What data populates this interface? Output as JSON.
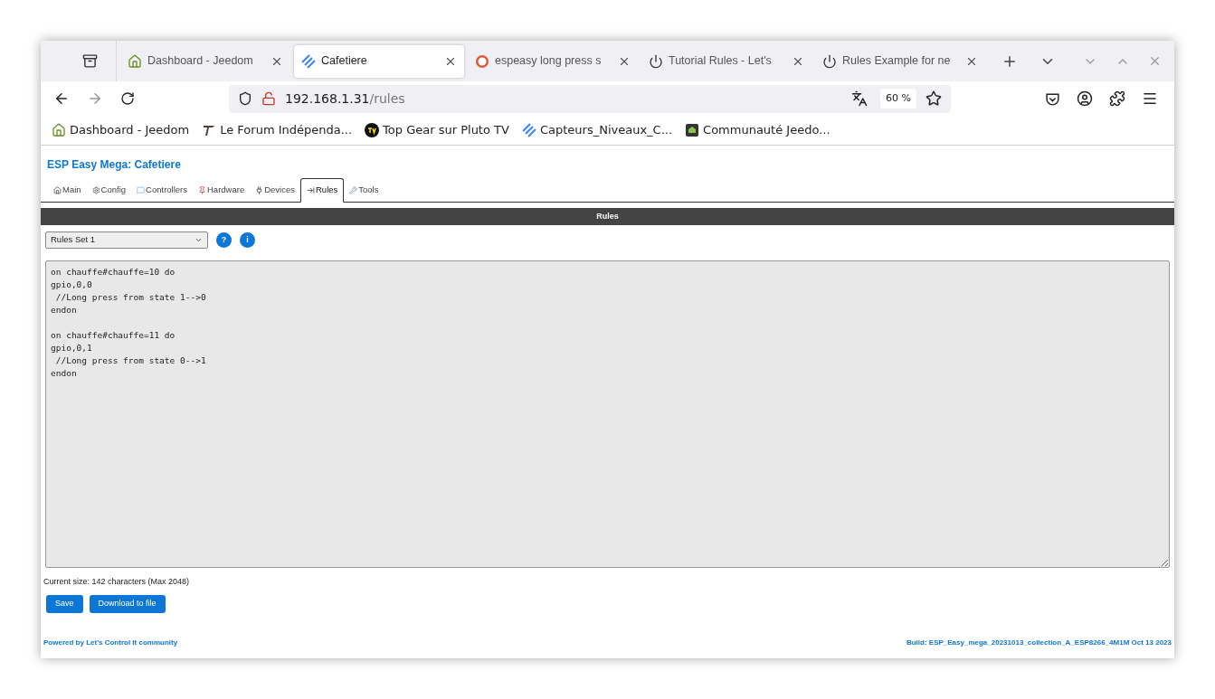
{
  "browser": {
    "tabs": [
      {
        "title": "Dashboard - Jeedom",
        "selected": false
      },
      {
        "title": "Cafetiere",
        "selected": true
      },
      {
        "title": "espeasy long press s",
        "selected": false
      },
      {
        "title": "Tutorial Rules - Let's",
        "selected": false
      },
      {
        "title": "Rules Example for ne",
        "selected": false
      }
    ],
    "address": {
      "host": "192.168.1.31",
      "path": "/rules"
    },
    "zoom": "60 %",
    "bookmarks": [
      "Dashboard - Jeedom",
      "Le Forum Indépenda...",
      "Top Gear sur Pluto TV",
      "Capteurs_Niveaux_C...",
      "Communauté Jeedo..."
    ]
  },
  "page": {
    "title": "ESP Easy Mega: Cafetiere",
    "nav": [
      {
        "label": "Main",
        "selected": false
      },
      {
        "label": "Config",
        "selected": false
      },
      {
        "label": "Controllers",
        "selected": false
      },
      {
        "label": "Hardware",
        "selected": false
      },
      {
        "label": "Devices",
        "selected": false
      },
      {
        "label": "Rules",
        "selected": true
      },
      {
        "label": "Tools",
        "selected": false
      }
    ],
    "section_header": "Rules",
    "rules_set": {
      "value": "Rules Set 1"
    },
    "help_buttons": [
      "?",
      "i"
    ],
    "rules_text": "on chauffe#chauffe=10 do\ngpio,0,0\n //Long press from state 1-->0\nendon\n\non chauffe#chauffe=11 do\ngpio,0,1\n //Long press from state 0-->1\nendon",
    "size_note": "Current size: 142 characters (Max 2048)",
    "buttons": [
      "Save",
      "Download to file"
    ],
    "footer_left": "Powered by Let's Control It community",
    "footer_right": "Build: ESP_Easy_mega_20231013_collection_A_ESP8266_4M1M Oct 13 2023"
  }
}
